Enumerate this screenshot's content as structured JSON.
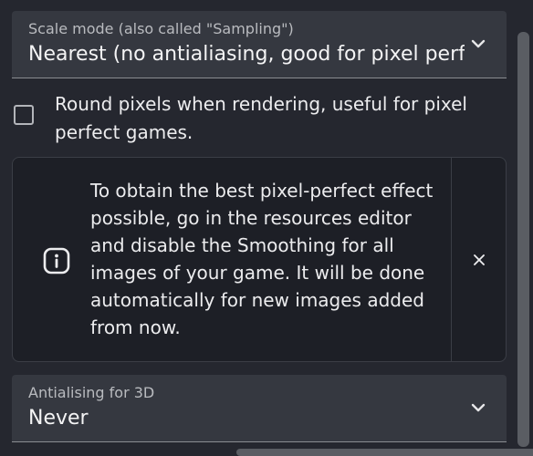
{
  "scale_mode": {
    "label": "Scale mode (also called \"Sampling\")",
    "value": "Nearest (no antialiasing, good for pixel perfect games)",
    "icon": "chevron-down-icon"
  },
  "round_pixels": {
    "label": "Round pixels when rendering, useful for pixel perfect games.",
    "checked": false
  },
  "alert": {
    "icon": "info-icon",
    "text": "To obtain the best pixel-perfect effect possible, go in the resources editor and disable the Smoothing for all images of your game. It will be done automatically for new images added from now.",
    "close_icon": "close-icon"
  },
  "antialiasing_3d": {
    "label": "Antialising for 3D",
    "value": "Never",
    "icon": "chevron-down-icon"
  },
  "colors": {
    "background": "#25272f",
    "field": "#353840",
    "alert_background": "#1d1f26",
    "text": "#ededee",
    "scrollbar": "#5a5d63"
  }
}
